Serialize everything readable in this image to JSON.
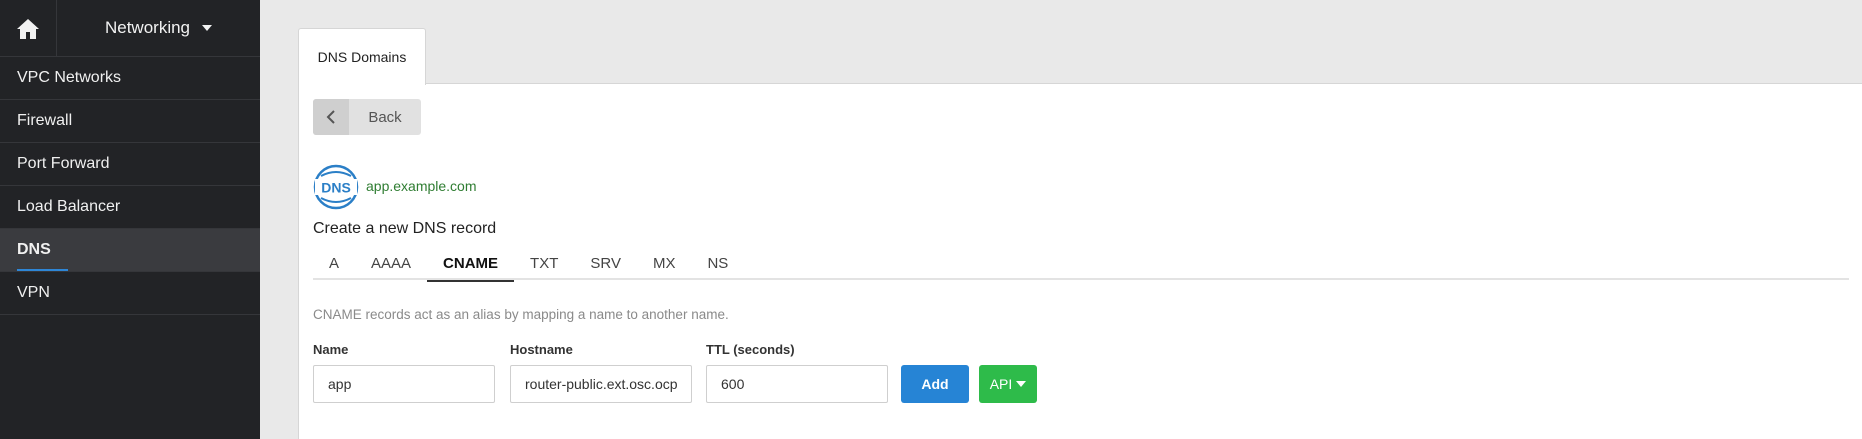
{
  "sidebar": {
    "section_label": "Networking",
    "items": [
      {
        "label": "VPC Networks"
      },
      {
        "label": "Firewall"
      },
      {
        "label": "Port Forward"
      },
      {
        "label": "Load Balancer"
      },
      {
        "label": "DNS",
        "active": true
      },
      {
        "label": "VPN"
      }
    ]
  },
  "tabs": {
    "dns_domains": "DNS Domains"
  },
  "back_button": {
    "label": "Back"
  },
  "domain": {
    "logo_text": "DNS",
    "name": "app.example.com"
  },
  "create_title": "Create a new DNS record",
  "record_types": [
    "A",
    "AAAA",
    "CNAME",
    "TXT",
    "SRV",
    "MX",
    "NS"
  ],
  "active_record_type": "CNAME",
  "description": "CNAME records act as an alias by mapping a name to another name.",
  "form": {
    "name_label": "Name",
    "name_value": "app",
    "hostname_label": "Hostname",
    "hostname_value": "router-public.ext.osc.ocp",
    "ttl_label": "TTL (seconds)",
    "ttl_value": "600",
    "add_label": "Add",
    "api_label": "API"
  },
  "colors": {
    "sidebar_bg": "#222326",
    "active_underline": "#2e86d6",
    "add_button": "#2684d5",
    "api_button": "#2ebb4a",
    "domain_text": "#2f7d32",
    "dns_logo": "#2b7fc7"
  }
}
